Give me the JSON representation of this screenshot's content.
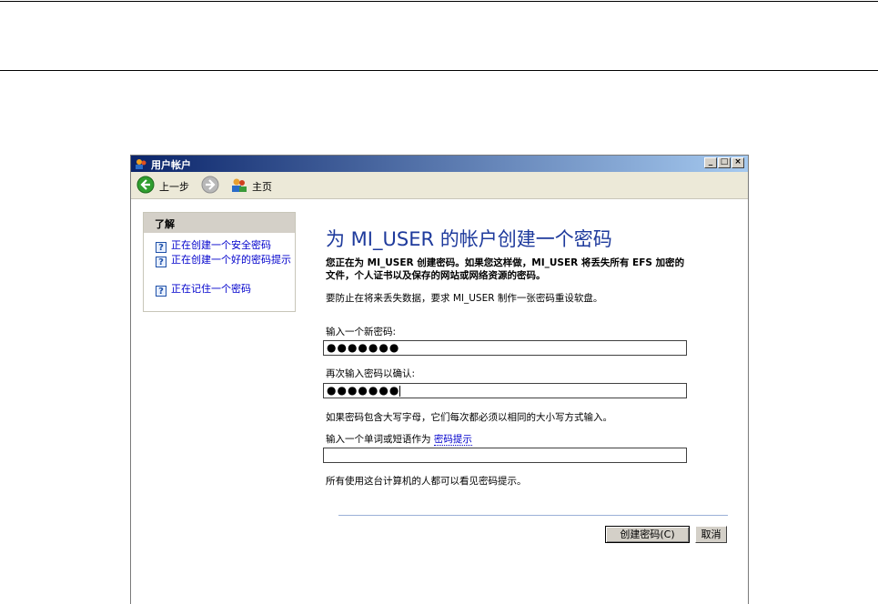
{
  "window": {
    "title": "用户帐户",
    "controls": {
      "minimize": "_",
      "maximize": "□",
      "close": "×"
    }
  },
  "toolbar": {
    "back_label": "上一步",
    "home_label": "主页",
    "icons": {
      "back": "back-arrow-icon",
      "forward": "forward-arrow-icon",
      "home": "user-accounts-home-icon"
    }
  },
  "sidebar": {
    "heading": "了解",
    "items": [
      {
        "label": "正在创建一个安全密码"
      },
      {
        "label": "正在创建一个好的密码提示"
      },
      {
        "label": "正在记住一个密码"
      }
    ]
  },
  "main": {
    "title": "为 MI_USER 的帐户创建一个密码",
    "warning": "您正在为 MI_USER 创建密码。如果您这样做，MI_USER 将丢失所有 EFS 加密的文件，个人证书以及保存的网站或网络资源的密码。",
    "info": "要防止在将来丢失数据，要求 MI_USER 制作一张密码重设软盘。",
    "new_password_label": "输入一个新密码:",
    "new_password_value": "●●●●●●●",
    "confirm_label": "再次输入密码以确认:",
    "confirm_value": "●●●●●●●",
    "case_note": "如果密码包含大写字母，它们每次都必须以相同的大小写方式输入。",
    "hint_label": "输入一个单词或短语作为",
    "hint_link": "密码提示",
    "hint_value": "",
    "hint_visibility_note": "所有使用这台计算机的人都可以看见密码提示。"
  },
  "buttons": {
    "create": "创建密码(C)",
    "cancel": "取消"
  },
  "colors": {
    "title_text": "#1e3a9c",
    "link": "#0000cc",
    "titlebar_start": "#0a246a",
    "titlebar_end": "#a6caf0"
  }
}
